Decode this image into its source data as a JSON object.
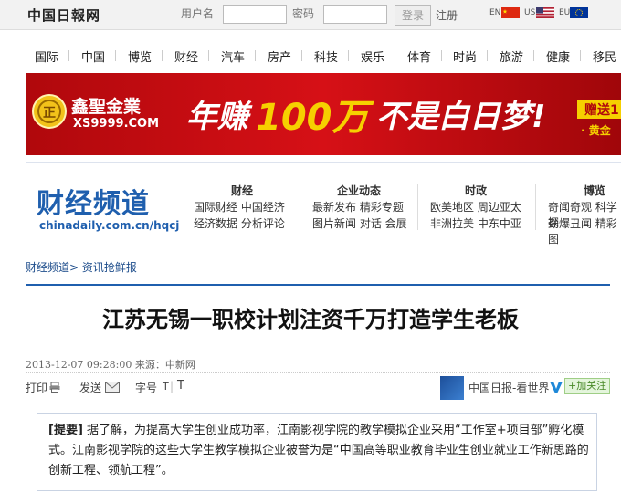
{
  "topbar": {
    "logo": "中国日報网",
    "username_label": "用户名",
    "password_label": "密码",
    "login_button": "登录",
    "register_link": "注册",
    "languages": [
      "EN",
      "US",
      "EU"
    ]
  },
  "nav": [
    "国际",
    "中国",
    "博览",
    "财经",
    "汽车",
    "房产",
    "科技",
    "娱乐",
    "体育",
    "时尚",
    "旅游",
    "健康",
    "移民"
  ],
  "banner": {
    "brand": "鑫聖金業",
    "site": "XS9999.COM",
    "slogan_a": "年赚",
    "slogan_b": "100万",
    "slogan_c": "不是白日梦!",
    "side_a": "赠送1",
    "side_b": "· 黄金"
  },
  "channel": {
    "title": "财经频道",
    "url": "chinadaily.com.cn/hqcj",
    "columns": [
      {
        "heading": "财经",
        "line1": "国际财经 中国经济",
        "line2": "经济数据 分析评论"
      },
      {
        "heading": "企业动态",
        "line1": "最新发布 精彩专题",
        "line2": "图片新闻 对话 会展"
      },
      {
        "heading": "时政",
        "line1": "欧美地区 周边亚太",
        "line2": "非洲拉美 中东中亚"
      },
      {
        "heading": "博览",
        "line1": "奇闻奇观 科学探",
        "line2": "劲爆丑闻 精彩图"
      }
    ]
  },
  "breadcrumb": "财经频道> 资讯抢鲜报",
  "article": {
    "headline": "江苏无锡一职校计划注资千万打造学生老板",
    "meta": "2013-12-07 09:28:00 来源：中新网",
    "tools": {
      "print": "打印",
      "send": "发送",
      "font_label": "字号",
      "font_t1": "T",
      "font_t2": "T"
    },
    "source_name": "中国日报-看世界",
    "follow": "+加关注",
    "summary_tag": "[提要]",
    "summary": " 据了解，为提高大学生创业成功率，江南影视学院的教学模拟企业采用“工作室+项目部”孵化模式。江南影视学院的这些大学生教学模拟企业被誉为是“中国高等职业教育毕业生创业就业工作新思路的创新工程、领航工程”。"
  },
  "colors": {
    "brand_blue": "#1f5fae",
    "banner_red": "#c40a10",
    "gold": "#f2c21a"
  }
}
